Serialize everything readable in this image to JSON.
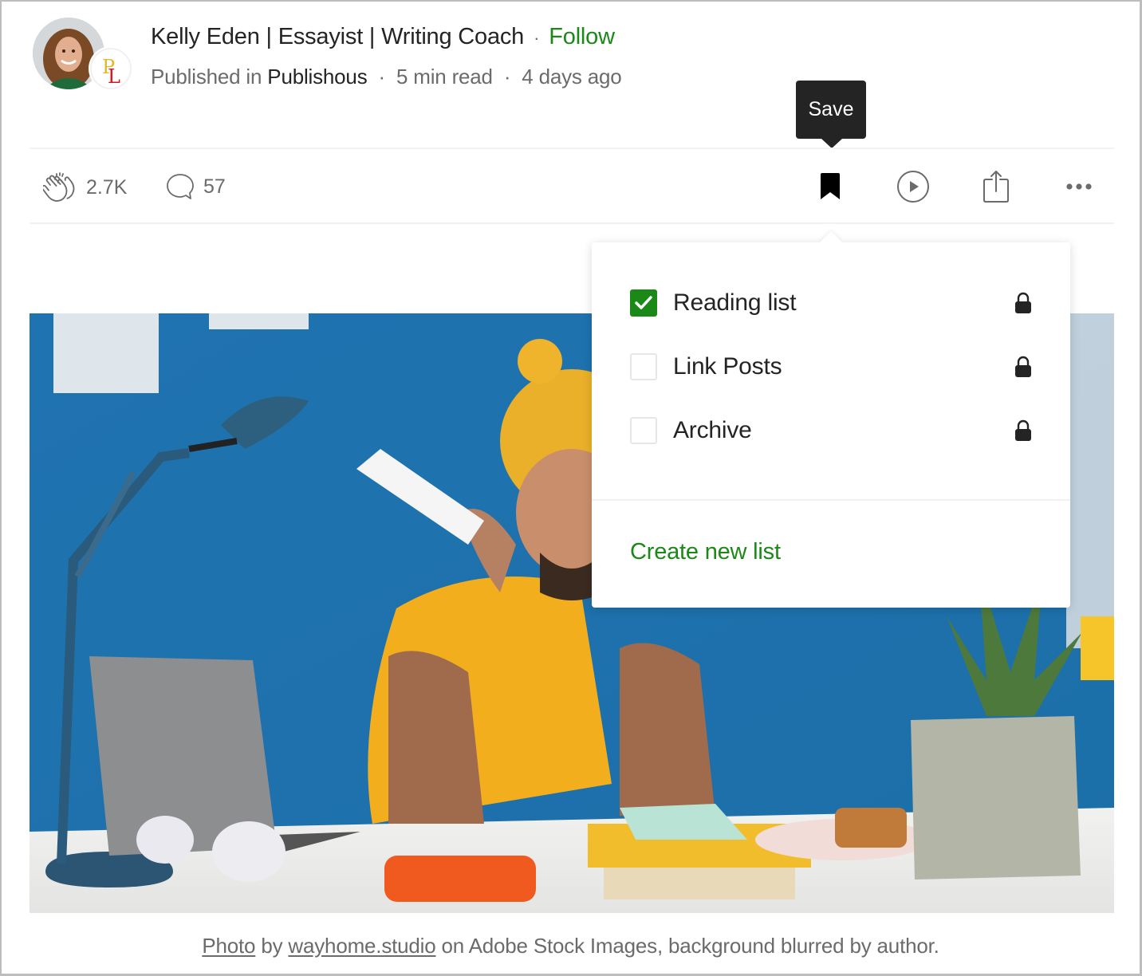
{
  "author": {
    "name": "Kelly Eden | Essayist | Writing Coach",
    "separator": "·",
    "follow_label": "Follow",
    "avatar_icon": "author-avatar",
    "publication_logo_text": "PL"
  },
  "meta": {
    "published_in_prefix": "Published in",
    "publication": "Publishous",
    "read_time": "5 min read",
    "posted": "4 days ago",
    "separator": "·"
  },
  "actions": {
    "claps": "2.7K",
    "responses": "57",
    "clap_icon": "clap-icon",
    "response_icon": "speech-bubble-icon",
    "save_icon": "bookmark-filled-icon",
    "listen_icon": "play-circle-icon",
    "share_icon": "share-icon",
    "more_icon": "more-horizontal-icon"
  },
  "tooltip": {
    "label": "Save"
  },
  "save_popover": {
    "lists": [
      {
        "label": "Reading list",
        "checked": true,
        "private": true
      },
      {
        "label": "Link Posts",
        "checked": false,
        "private": true
      },
      {
        "label": "Archive",
        "checked": false,
        "private": true
      }
    ],
    "create_label": "Create new list"
  },
  "caption": {
    "photo_link": "Photo",
    "by": "by",
    "photographer_link": "wayhome.studio",
    "rest": "on Adobe Stock Images, background blurred by author."
  },
  "colors": {
    "accent_green": "#1a8917",
    "text_primary": "#242424",
    "text_secondary": "#6b6b6b",
    "tooltip_bg": "#242424"
  }
}
